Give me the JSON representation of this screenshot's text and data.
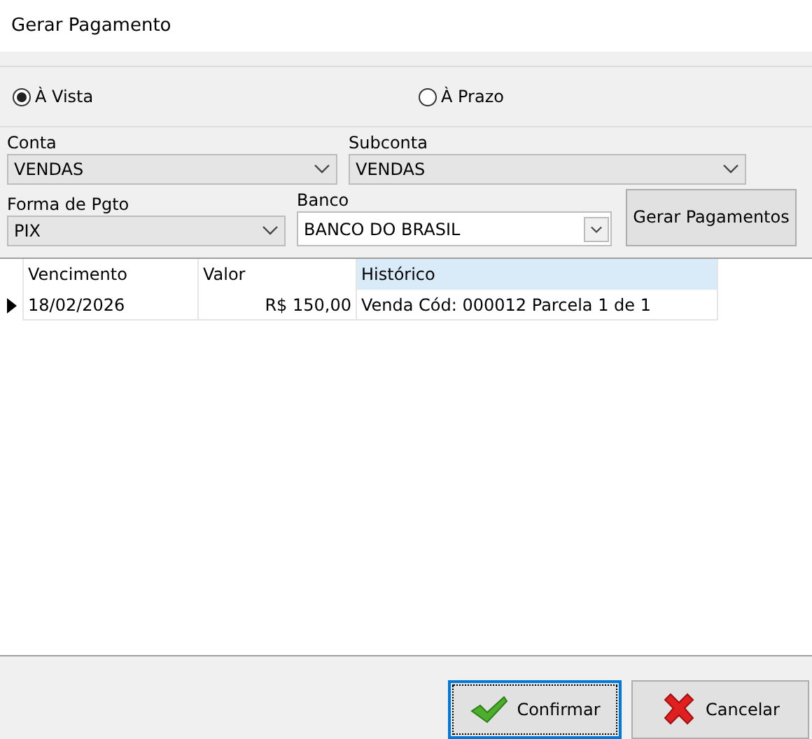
{
  "window": {
    "title": "Gerar Pagamento"
  },
  "payment_type": [
    {
      "label": "À Vista",
      "selected": true
    },
    {
      "label": "À Prazo",
      "selected": false
    }
  ],
  "conta": {
    "label": "Conta",
    "value": "VENDAS"
  },
  "subconta": {
    "label": "Subconta",
    "value": "VENDAS"
  },
  "forma": {
    "label": "Forma de Pgto",
    "value": "PIX"
  },
  "banco": {
    "label": "Banco",
    "value": "BANCO DO BRASIL"
  },
  "generate_button": "Gerar Pagamentos",
  "table": {
    "columns": [
      {
        "label": "Vencimento",
        "highlighted": false
      },
      {
        "label": "Valor",
        "highlighted": false
      },
      {
        "label": "Histórico",
        "highlighted": true
      }
    ],
    "rows": [
      {
        "current": true,
        "cells": [
          "18/02/2026",
          "R$ 150,00",
          "Venda Cód: 000012 Parcela 1 de 1"
        ]
      }
    ]
  },
  "buttons": [
    {
      "kind": "confirm",
      "label": "Confirmar",
      "focused": true
    },
    {
      "kind": "cancel",
      "label": "Cancelar",
      "focused": false
    }
  ]
}
